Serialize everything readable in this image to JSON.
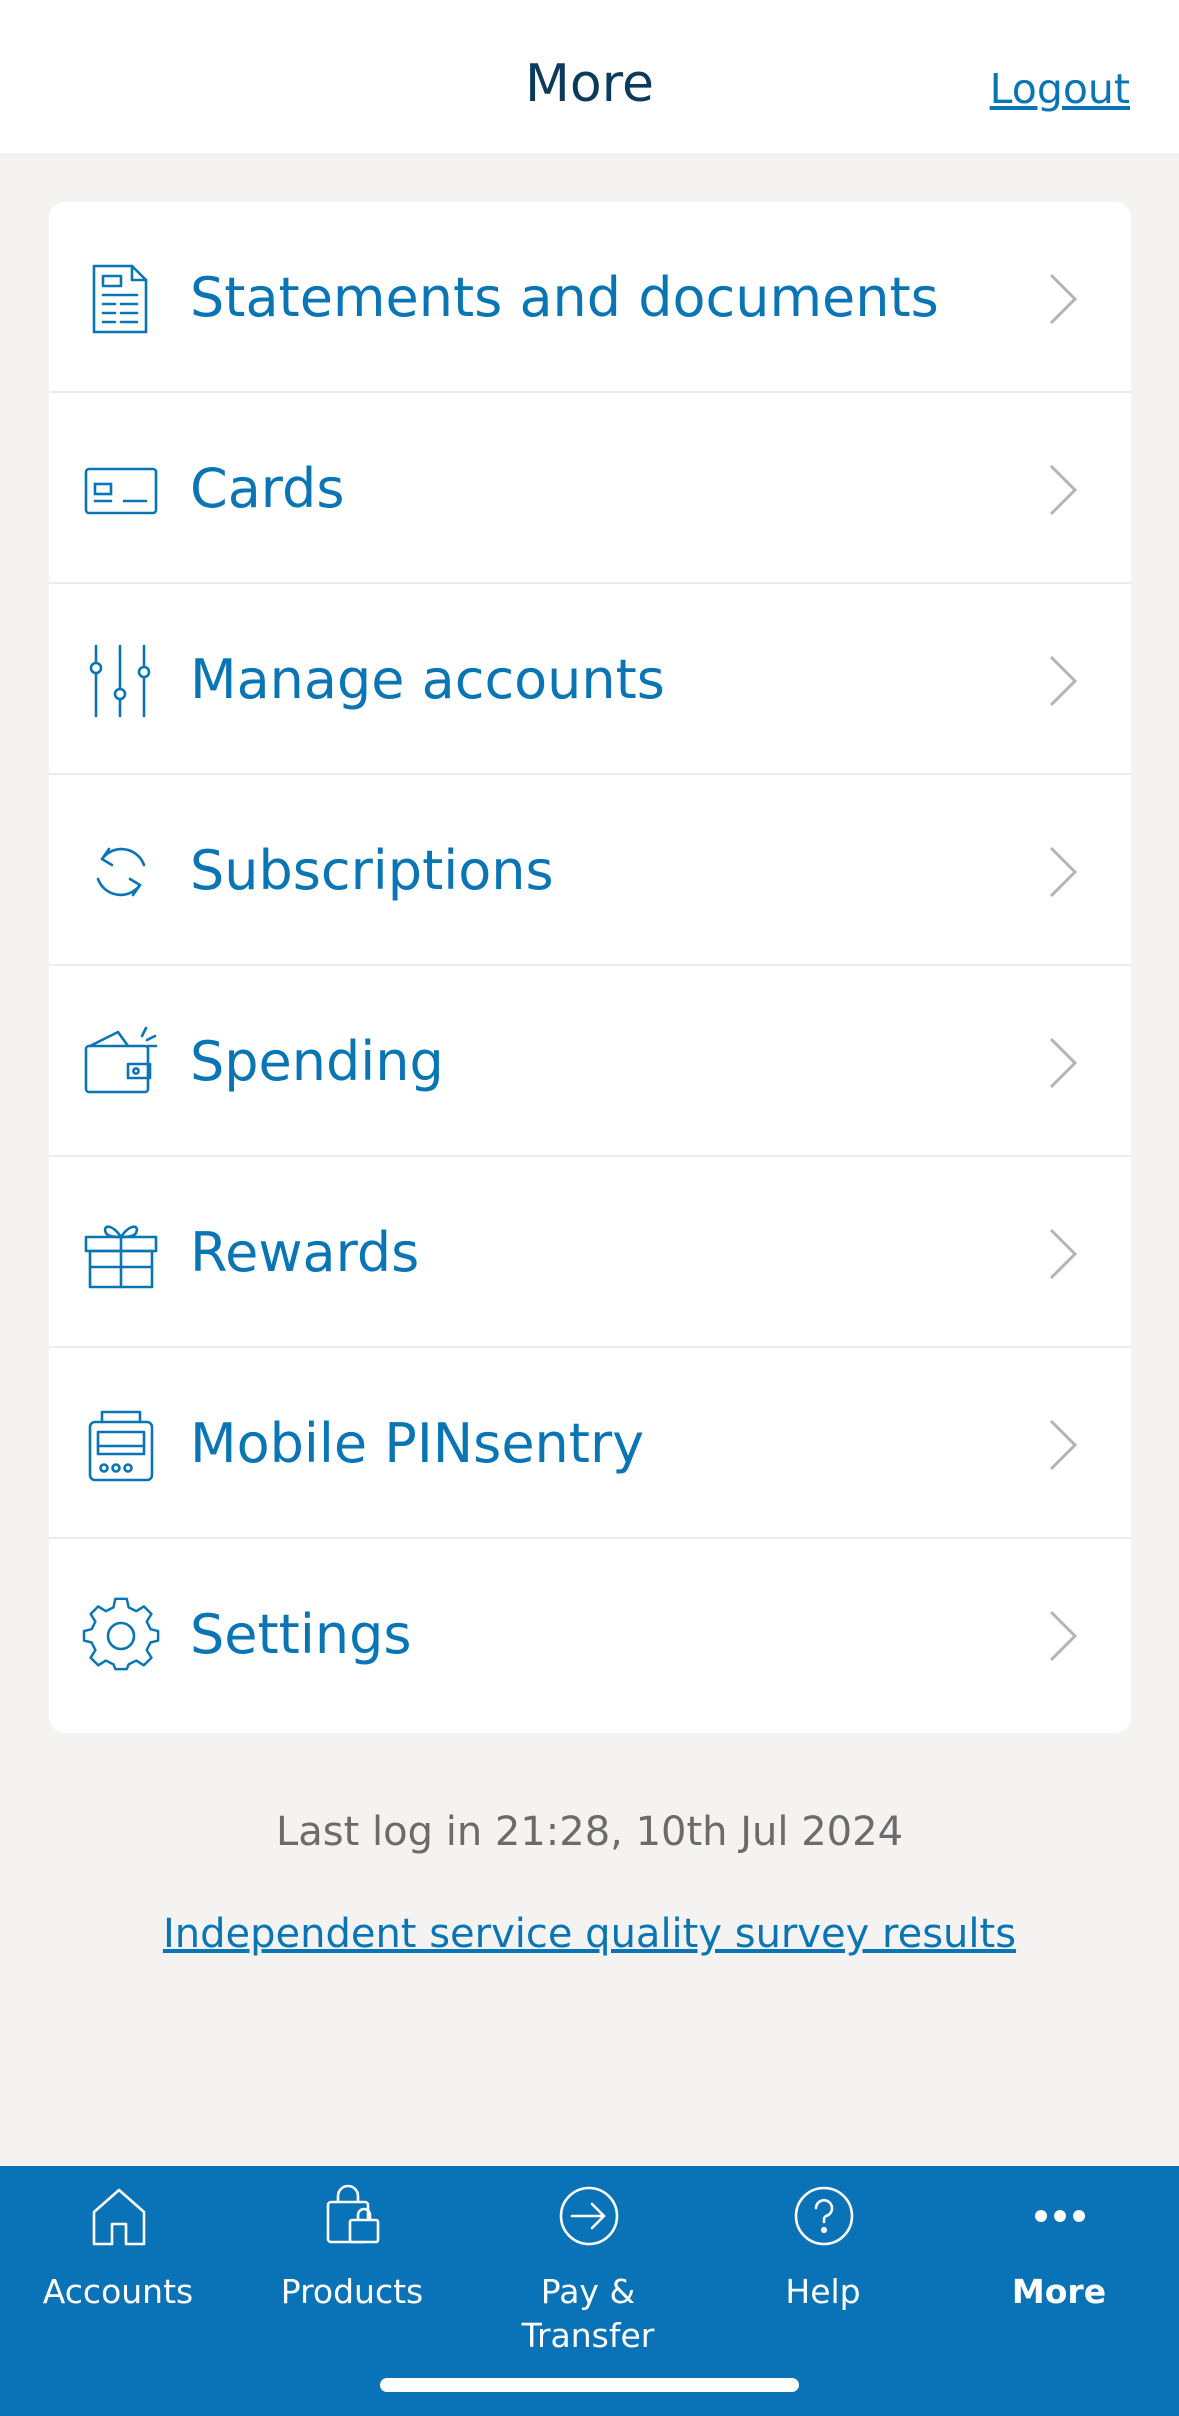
{
  "header": {
    "title": "More",
    "logout_label": "Logout"
  },
  "menu": {
    "items": [
      {
        "label": "Statements and documents",
        "icon": "document-icon"
      },
      {
        "label": "Cards",
        "icon": "card-icon"
      },
      {
        "label": "Manage accounts",
        "icon": "sliders-icon"
      },
      {
        "label": "Subscriptions",
        "icon": "refresh-icon"
      },
      {
        "label": "Spending",
        "icon": "wallet-icon"
      },
      {
        "label": "Rewards",
        "icon": "gift-icon"
      },
      {
        "label": "Mobile PINsentry",
        "icon": "card-reader-icon"
      },
      {
        "label": "Settings",
        "icon": "gear-icon"
      }
    ]
  },
  "footer": {
    "last_login": "Last log in 21:28, 10th Jul 2024",
    "survey_link": "Independent service quality survey results"
  },
  "tabbar": {
    "tabs": [
      {
        "label": "Accounts",
        "icon": "home-icon"
      },
      {
        "label": "Products",
        "icon": "shopping-bag-icon"
      },
      {
        "label": "Pay & Transfer",
        "icon": "arrow-circle-icon"
      },
      {
        "label": "Help",
        "icon": "question-circle-icon"
      },
      {
        "label": "More",
        "icon": "more-dots-icon",
        "active": true
      }
    ]
  },
  "colors": {
    "accent": "#0a75b5",
    "tabbar_bg": "#0a72b6",
    "background": "#f4f3f2",
    "title": "#0b3a5b"
  }
}
